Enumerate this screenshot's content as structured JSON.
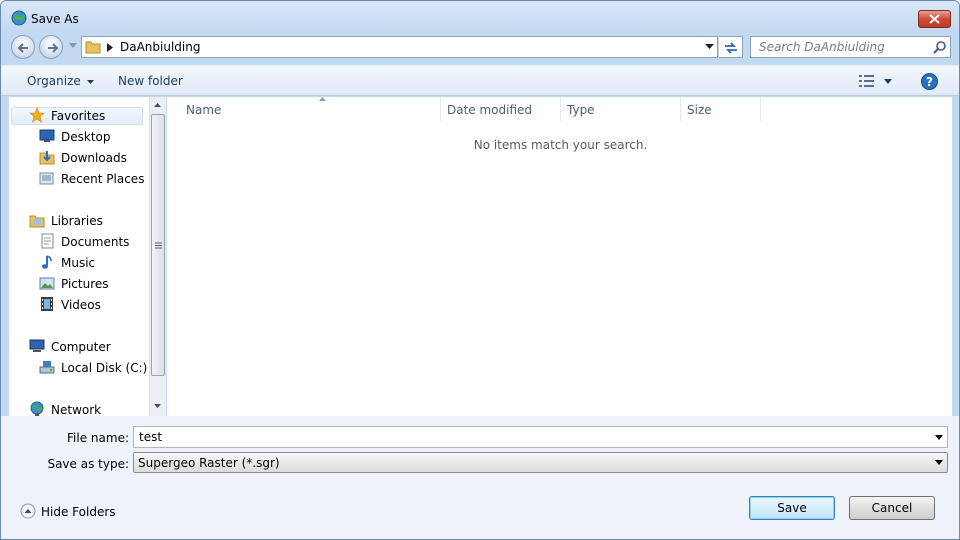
{
  "window": {
    "title": "Save As"
  },
  "address": {
    "path": "DaAnbiulding"
  },
  "search": {
    "placeholder": "Search DaAnbiulding"
  },
  "toolbar": {
    "organize": "Organize",
    "new_folder": "New folder"
  },
  "nav": {
    "favorites": "Favorites",
    "desktop": "Desktop",
    "downloads": "Downloads",
    "recent": "Recent Places",
    "libraries": "Libraries",
    "documents": "Documents",
    "music": "Music",
    "pictures": "Pictures",
    "videos": "Videos",
    "computer": "Computer",
    "localdisk": "Local Disk (C:)",
    "network": "Network"
  },
  "columns": {
    "name": "Name",
    "date": "Date modified",
    "type": "Type",
    "size": "Size"
  },
  "files": {
    "empty_message": "No items match your search."
  },
  "form": {
    "filename_label": "File name:",
    "filename_value": "test",
    "type_label": "Save as type:",
    "type_value": "Supergeo Raster (*.sgr)"
  },
  "footer": {
    "hide_folders": "Hide Folders",
    "save": "Save",
    "cancel": "Cancel"
  },
  "colors": {
    "accent": "#3c7fb1",
    "frame": "#c2d9f2",
    "close": "#cf4c36"
  }
}
